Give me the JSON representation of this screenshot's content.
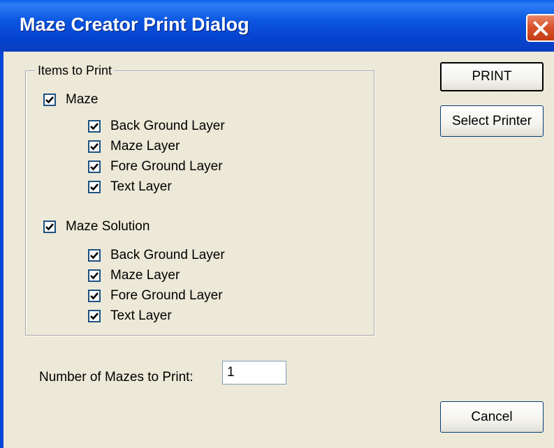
{
  "window": {
    "title": "Maze Creator Print Dialog"
  },
  "group": {
    "label": "Items to Print",
    "maze": {
      "label": "Maze",
      "checked": true,
      "layers": [
        {
          "label": "Back Ground Layer",
          "checked": true
        },
        {
          "label": "Maze Layer",
          "checked": true
        },
        {
          "label": "Fore Ground Layer",
          "checked": true
        },
        {
          "label": "Text Layer",
          "checked": true
        }
      ]
    },
    "solution": {
      "label": "Maze Solution",
      "checked": true,
      "layers": [
        {
          "label": "Back Ground Layer",
          "checked": true
        },
        {
          "label": "Maze Layer",
          "checked": true
        },
        {
          "label": "Fore Ground Layer",
          "checked": true
        },
        {
          "label": "Text Layer",
          "checked": true
        }
      ]
    }
  },
  "count": {
    "label": "Number of Mazes to Print:",
    "value": "1"
  },
  "buttons": {
    "print": "PRINT",
    "select_printer": "Select Printer",
    "cancel": "Cancel"
  },
  "icons": {
    "close": "close-icon",
    "check": "checkmark-icon"
  },
  "colors": {
    "title_bar": "#0846D8",
    "dialog_bg": "#ECE9D8",
    "close_button": "#D9542E"
  }
}
